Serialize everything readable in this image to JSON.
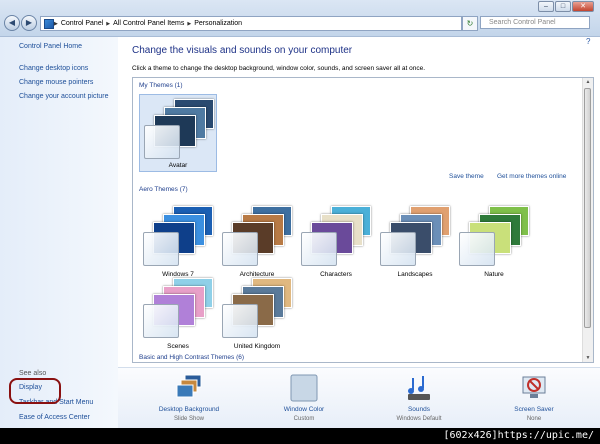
{
  "window": {
    "minimize": "–",
    "maximize": "□",
    "close": "✕"
  },
  "nav": {
    "back": "◀",
    "forward": "▶"
  },
  "address": {
    "crumbs": [
      "Control Panel",
      "All Control Panel Items",
      "Personalization"
    ]
  },
  "search": {
    "placeholder": "Search Control Panel"
  },
  "help": "?",
  "sidebar": {
    "home": "Control Panel Home",
    "links": [
      "Change desktop icons",
      "Change mouse pointers",
      "Change your account picture"
    ],
    "see_also": "See also",
    "see_also_links": [
      "Display",
      "Taskbar and Start Menu",
      "Ease of Access Center"
    ]
  },
  "main": {
    "heading": "Change the visuals and sounds on your computer",
    "subtext": "Click a theme to change the desktop background, window color, sounds, and screen saver all at once."
  },
  "themes": {
    "my_themes_header": "My Themes (1)",
    "my_themes": [
      {
        "name": "Avatar",
        "selected": true,
        "colors": [
          "#2a4a70",
          "#4f7aa2",
          "#1e3957"
        ]
      }
    ],
    "save_theme": "Save theme",
    "get_more": "Get more themes online",
    "aero_header": "Aero Themes (7)",
    "aero": [
      {
        "name": "Windows 7",
        "colors": [
          "#1b5fb3",
          "#3b8fe0",
          "#0e3f8a"
        ]
      },
      {
        "name": "Architecture",
        "colors": [
          "#3e6fa0",
          "#b87a45",
          "#5a3c28"
        ]
      },
      {
        "name": "Characters",
        "colors": [
          "#4bb0d8",
          "#e8e0c8",
          "#6a4a9a"
        ]
      },
      {
        "name": "Landscapes",
        "colors": [
          "#e0a070",
          "#6b8fb8",
          "#3a4d6a"
        ]
      },
      {
        "name": "Nature",
        "colors": [
          "#7fc04a",
          "#2e7a3a",
          "#c9e07a"
        ]
      },
      {
        "name": "Scenes",
        "colors": [
          "#8fd0e8",
          "#e8a0c8",
          "#b080d8"
        ]
      },
      {
        "name": "United Kingdom",
        "colors": [
          "#e0b880",
          "#5a7a9a",
          "#8a6a48"
        ]
      }
    ],
    "basic_header": "Basic and High Contrast Themes (6)"
  },
  "toolbar": [
    {
      "label": "Desktop Background",
      "sub": "Slide Show",
      "icon": "desktop-background-icon"
    },
    {
      "label": "Window Color",
      "sub": "Custom",
      "icon": "window-color-icon"
    },
    {
      "label": "Sounds",
      "sub": "Windows Default",
      "icon": "sounds-icon"
    },
    {
      "label": "Screen Saver",
      "sub": "None",
      "icon": "screen-saver-icon"
    }
  ],
  "watermark": "[602x426]https://upic.me/"
}
